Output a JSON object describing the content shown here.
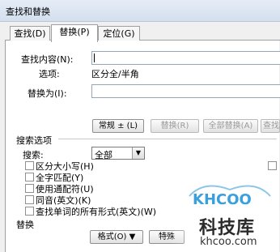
{
  "window": {
    "title": "查找和替换"
  },
  "tabs": [
    {
      "label": "查找(D)"
    },
    {
      "label": "替换(P)"
    },
    {
      "label": "定位(G)"
    }
  ],
  "find": {
    "label": "查找内容(N):",
    "value": ""
  },
  "options": {
    "label": "选项:",
    "value": "区分全/半角"
  },
  "replace": {
    "label": "替换为(I):",
    "value": ""
  },
  "buttons": {
    "more": "常规 ± (L)",
    "replace": "替换(R)",
    "replace_all": "全部替换(A)",
    "find_next": "查找"
  },
  "search_options": {
    "title": "搜索选项",
    "search_label": "搜索:",
    "search_value": "全部",
    "checkboxes": [
      {
        "label": "区分大小写(H)",
        "checked": false
      },
      {
        "label": "全字匹配(Y)",
        "checked": false
      },
      {
        "label": "使用通配符(U)",
        "checked": false
      },
      {
        "label": "同音(英文)(K)",
        "checked": false
      },
      {
        "label": "查找单词的所有形式(英文)(W)",
        "checked": false
      }
    ]
  },
  "replace_section": {
    "title": "替换",
    "format_btn": "格式(O) ▼",
    "special_btn": "特殊"
  },
  "watermark": {
    "logo": "KHCOO",
    "name": "科技库",
    "url": "khcoo.com"
  },
  "colors": {
    "titlebar": "#dbe5f1",
    "panel": "#ffffff",
    "window": "#f0f0f0"
  }
}
